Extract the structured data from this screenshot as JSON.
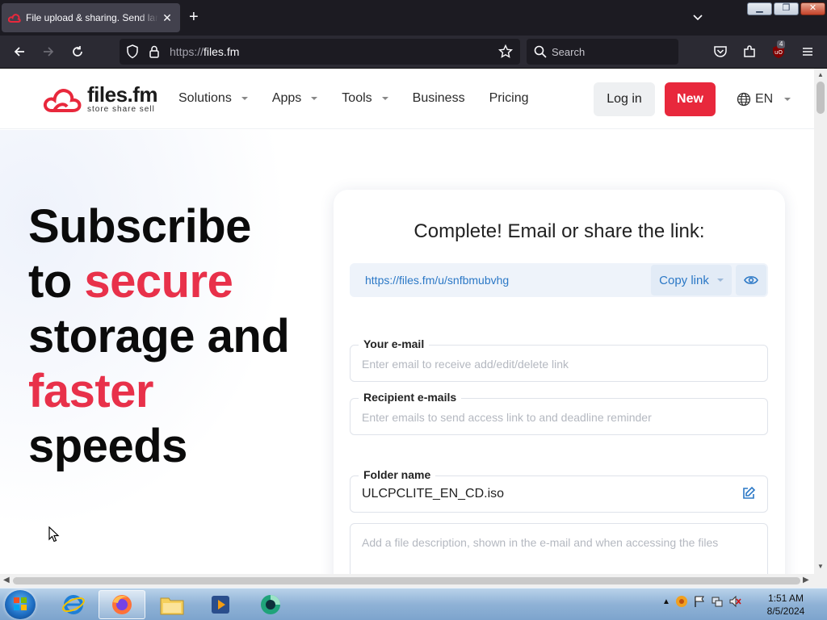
{
  "browser": {
    "tab_title": "File upload & sharing. Send large files",
    "tab_close": "✕",
    "new_tab": "+",
    "url_scheme": "https://",
    "url_host": "files.fm",
    "search_placeholder": "Search",
    "extension_badge": "4"
  },
  "site": {
    "logo_name": "files.fm",
    "logo_tagline": "store share sell",
    "nav": [
      {
        "label": "Solutions",
        "has_dropdown": true
      },
      {
        "label": "Apps",
        "has_dropdown": true
      },
      {
        "label": "Tools",
        "has_dropdown": true
      },
      {
        "label": "Business",
        "has_dropdown": false
      },
      {
        "label": "Pricing",
        "has_dropdown": false
      }
    ],
    "login_label": "Log in",
    "new_label": "New",
    "language": "EN",
    "accent_color": "#e8283c",
    "link_color": "#2b78c6"
  },
  "hero": {
    "line1": "Subscribe",
    "line2_plain": "to ",
    "line2_red": "secure",
    "line3": "storage and",
    "line4_red": "faster",
    "line5": "speeds"
  },
  "share": {
    "title": "Complete! Email or share the link:",
    "link": "https://files.fm/u/snfbmubvhg",
    "copy_label": "Copy link",
    "email_label": "Your e-mail",
    "email_placeholder": "Enter email to receive add/edit/delete link",
    "recipient_label": "Recipient e-mails",
    "recipient_placeholder": "Enter emails to send access link to and deadline reminder",
    "folder_label": "Folder name",
    "folder_value": "ULCPCLITE_EN_CD.iso",
    "description_placeholder": "Add a file description, shown in the e-mail and when accessing the files"
  },
  "taskbar": {
    "time": "1:51 AM",
    "date": "8/5/2024"
  }
}
